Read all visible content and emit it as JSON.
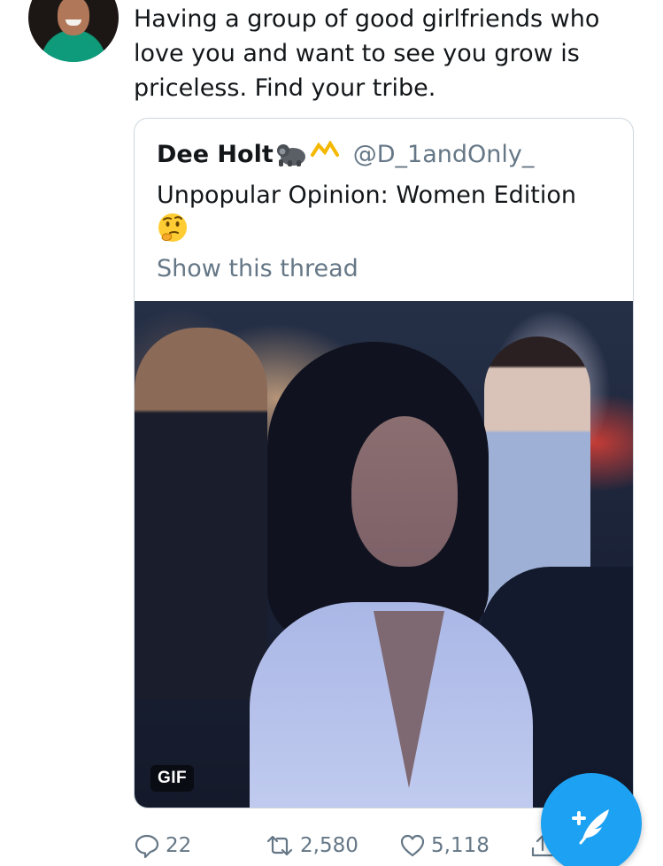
{
  "tweet": {
    "text": "Having a group of good girlfriends who\nlove you and want to see you grow is\npriceless. Find your tribe."
  },
  "quoted_tweet": {
    "name": "Dee Holt",
    "handle": "@D_1andOnly_",
    "text": "Unpopular Opinion: Women Edition",
    "emoji_icon": "thinking-face-icon",
    "show_thread": "Show this thread",
    "media_badge": "GIF"
  },
  "actions": {
    "reply_count": "22",
    "retweet_count": "2,580",
    "like_count": "5,118"
  },
  "colors": {
    "accent": "#1da1f2",
    "secondary_text": "#657786",
    "border": "#ccd6dd",
    "primary_text": "#14171a"
  }
}
